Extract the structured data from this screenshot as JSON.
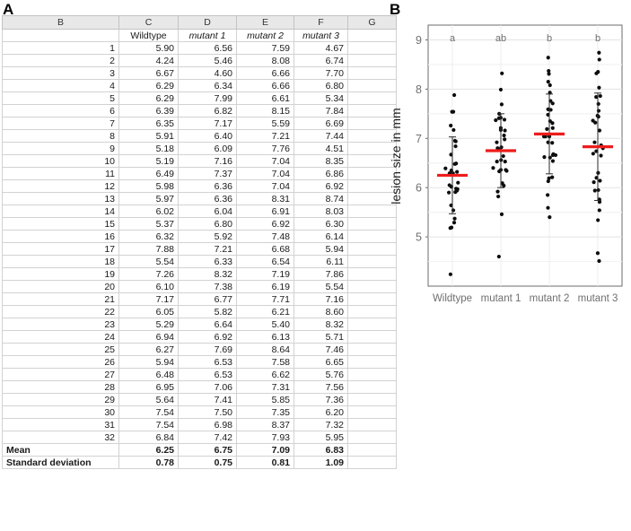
{
  "figure": {
    "panel_a_label": "A",
    "panel_b_label": "B"
  },
  "spreadsheet": {
    "column_letters": [
      "B",
      "C",
      "D",
      "E",
      "F",
      "G"
    ],
    "series_names": {
      "wildtype": "Wildtype",
      "mutant1": "mutant 1",
      "mutant2": "mutant 2",
      "mutant3": "mutant 3"
    },
    "row_indices": [
      "1",
      "2",
      "3",
      "4",
      "5",
      "6",
      "7",
      "8",
      "9",
      "10",
      "11",
      "12",
      "13",
      "14",
      "15",
      "16",
      "17",
      "18",
      "19",
      "20",
      "21",
      "22",
      "23",
      "24",
      "25",
      "26",
      "27",
      "28",
      "29",
      "30",
      "31",
      "32"
    ],
    "rows": [
      {
        "n": "1",
        "wildtype": "5.90",
        "mutant1": "6.56",
        "mutant2": "7.59",
        "mutant3": "4.67"
      },
      {
        "n": "2",
        "wildtype": "4.24",
        "mutant1": "5.46",
        "mutant2": "8.08",
        "mutant3": "6.74"
      },
      {
        "n": "3",
        "wildtype": "6.67",
        "mutant1": "4.60",
        "mutant2": "6.66",
        "mutant3": "7.70"
      },
      {
        "n": "4",
        "wildtype": "6.29",
        "mutant1": "6.34",
        "mutant2": "6.66",
        "mutant3": "6.80"
      },
      {
        "n": "5",
        "wildtype": "6.29",
        "mutant1": "7.99",
        "mutant2": "6.61",
        "mutant3": "5.34"
      },
      {
        "n": "6",
        "wildtype": "6.39",
        "mutant1": "6.82",
        "mutant2": "8.15",
        "mutant3": "7.84"
      },
      {
        "n": "7",
        "wildtype": "6.35",
        "mutant1": "7.17",
        "mutant2": "5.59",
        "mutant3": "6.69"
      },
      {
        "n": "8",
        "wildtype": "5.91",
        "mutant1": "6.40",
        "mutant2": "7.21",
        "mutant3": "7.44"
      },
      {
        "n": "9",
        "wildtype": "5.18",
        "mutant1": "6.09",
        "mutant2": "7.76",
        "mutant3": "4.51"
      },
      {
        "n": "10",
        "wildtype": "5.19",
        "mutant1": "7.16",
        "mutant2": "7.04",
        "mutant3": "8.35"
      },
      {
        "n": "11",
        "wildtype": "6.49",
        "mutant1": "7.37",
        "mutant2": "7.04",
        "mutant3": "6.86"
      },
      {
        "n": "12",
        "wildtype": "5.98",
        "mutant1": "6.36",
        "mutant2": "7.04",
        "mutant3": "6.92"
      },
      {
        "n": "13",
        "wildtype": "5.97",
        "mutant1": "6.36",
        "mutant2": "8.31",
        "mutant3": "8.74"
      },
      {
        "n": "14",
        "wildtype": "6.02",
        "mutant1": "6.04",
        "mutant2": "6.91",
        "mutant3": "8.03"
      },
      {
        "n": "15",
        "wildtype": "5.37",
        "mutant1": "6.80",
        "mutant2": "6.92",
        "mutant3": "6.30"
      },
      {
        "n": "16",
        "wildtype": "6.32",
        "mutant1": "5.92",
        "mutant2": "7.48",
        "mutant3": "6.14"
      },
      {
        "n": "17",
        "wildtype": "7.88",
        "mutant1": "7.21",
        "mutant2": "6.68",
        "mutant3": "5.94"
      },
      {
        "n": "18",
        "wildtype": "5.54",
        "mutant1": "6.33",
        "mutant2": "6.54",
        "mutant3": "6.11"
      },
      {
        "n": "19",
        "wildtype": "7.26",
        "mutant1": "8.32",
        "mutant2": "7.19",
        "mutant3": "7.86"
      },
      {
        "n": "20",
        "wildtype": "6.10",
        "mutant1": "7.38",
        "mutant2": "6.19",
        "mutant3": "5.54"
      },
      {
        "n": "21",
        "wildtype": "7.17",
        "mutant1": "6.77",
        "mutant2": "7.71",
        "mutant3": "7.16"
      },
      {
        "n": "22",
        "wildtype": "6.05",
        "mutant1": "5.82",
        "mutant2": "6.21",
        "mutant3": "8.60"
      },
      {
        "n": "23",
        "wildtype": "5.29",
        "mutant1": "6.64",
        "mutant2": "5.40",
        "mutant3": "8.32"
      },
      {
        "n": "24",
        "wildtype": "6.94",
        "mutant1": "6.92",
        "mutant2": "6.13",
        "mutant3": "5.71"
      },
      {
        "n": "25",
        "wildtype": "6.27",
        "mutant1": "7.69",
        "mutant2": "8.64",
        "mutant3": "7.46"
      },
      {
        "n": "26",
        "wildtype": "5.94",
        "mutant1": "6.53",
        "mutant2": "7.58",
        "mutant3": "6.65"
      },
      {
        "n": "27",
        "wildtype": "6.48",
        "mutant1": "6.53",
        "mutant2": "6.62",
        "mutant3": "5.76"
      },
      {
        "n": "28",
        "wildtype": "6.95",
        "mutant1": "7.06",
        "mutant2": "7.31",
        "mutant3": "7.56"
      },
      {
        "n": "29",
        "wildtype": "5.64",
        "mutant1": "7.41",
        "mutant2": "5.85",
        "mutant3": "7.36"
      },
      {
        "n": "30",
        "wildtype": "7.54",
        "mutant1": "7.50",
        "mutant2": "7.35",
        "mutant3": "6.20"
      },
      {
        "n": "31",
        "wildtype": "7.54",
        "mutant1": "6.98",
        "mutant2": "8.37",
        "mutant3": "7.32"
      },
      {
        "n": "32",
        "wildtype": "6.84",
        "mutant1": "7.42",
        "mutant2": "7.93",
        "mutant3": "5.95"
      }
    ],
    "stats": [
      {
        "label": "Mean",
        "wildtype": "6.25",
        "mutant1": "6.75",
        "mutant2": "7.09",
        "mutant3": "6.83"
      },
      {
        "label": "Standard deviation",
        "wildtype": "0.78",
        "mutant1": "0.75",
        "mutant2": "0.81",
        "mutant3": "1.09"
      }
    ]
  },
  "chart_data": {
    "type": "scatter",
    "title": "",
    "xlabel": "",
    "ylabel": "lesion size in mm",
    "categories": [
      "Wildtype",
      "mutant 1",
      "mutant 2",
      "mutant 3"
    ],
    "yticks": [
      5,
      6,
      7,
      8,
      9
    ],
    "ylim": [
      4.0,
      9.3
    ],
    "grid": true,
    "legend": "none",
    "annotations": [
      "a",
      "ab",
      "b",
      "b"
    ],
    "mean_marker_color": "#ee1c1c",
    "point_color": "#0d0d0d",
    "means": [
      6.25,
      6.75,
      7.09,
      6.83
    ],
    "sds": [
      0.78,
      0.75,
      0.81,
      1.09
    ],
    "series": [
      {
        "name": "Wildtype",
        "values": [
          5.9,
          4.24,
          6.67,
          6.29,
          6.29,
          6.39,
          6.35,
          5.91,
          5.18,
          5.19,
          6.49,
          5.98,
          5.97,
          6.02,
          5.37,
          6.32,
          7.88,
          5.54,
          7.26,
          6.1,
          7.17,
          6.05,
          5.29,
          6.94,
          6.27,
          5.94,
          6.48,
          6.95,
          5.64,
          7.54,
          7.54,
          6.84
        ]
      },
      {
        "name": "mutant 1",
        "values": [
          6.56,
          5.46,
          4.6,
          6.34,
          7.99,
          6.82,
          7.17,
          6.4,
          6.09,
          7.16,
          7.37,
          6.36,
          6.36,
          6.04,
          6.8,
          5.92,
          7.21,
          6.33,
          8.32,
          7.38,
          6.77,
          5.82,
          6.64,
          6.92,
          7.69,
          6.53,
          6.53,
          7.06,
          7.41,
          7.5,
          6.98,
          7.42
        ]
      },
      {
        "name": "mutant 2",
        "values": [
          7.59,
          8.08,
          6.66,
          6.66,
          6.61,
          8.15,
          5.59,
          7.21,
          7.76,
          7.04,
          7.04,
          7.04,
          8.31,
          6.91,
          6.92,
          7.48,
          6.68,
          6.54,
          7.19,
          6.19,
          7.71,
          6.21,
          5.4,
          6.13,
          8.64,
          7.58,
          6.62,
          7.31,
          5.85,
          7.35,
          8.37,
          7.93
        ]
      },
      {
        "name": "mutant 3",
        "values": [
          4.67,
          6.74,
          7.7,
          6.8,
          5.34,
          7.84,
          6.69,
          7.44,
          4.51,
          8.35,
          6.86,
          6.92,
          8.74,
          8.03,
          6.3,
          6.14,
          5.94,
          6.11,
          7.86,
          5.54,
          7.16,
          8.6,
          8.32,
          5.71,
          7.46,
          6.65,
          5.76,
          7.56,
          7.36,
          6.2,
          7.32,
          5.95
        ]
      }
    ]
  }
}
